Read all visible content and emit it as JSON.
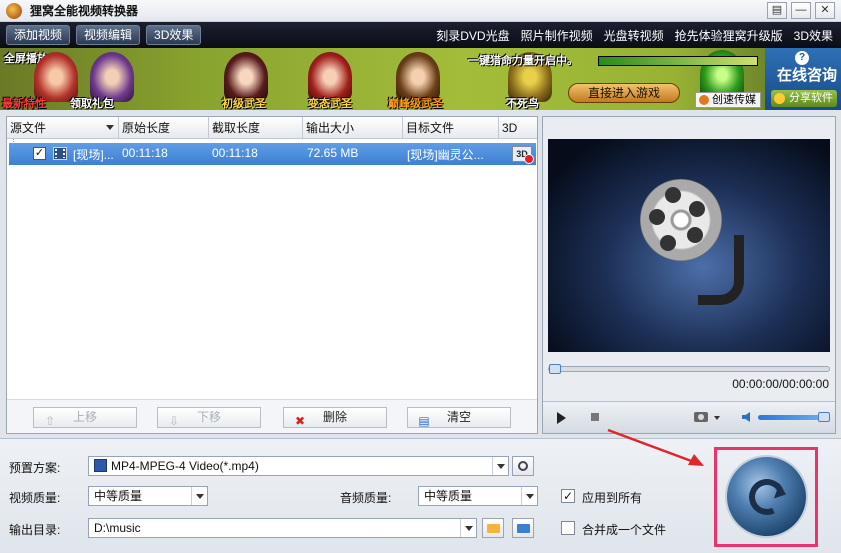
{
  "app": {
    "title": "狸窝全能视频转换器"
  },
  "window_controls": {
    "menu": "▤",
    "minimize": "—",
    "close": "✕"
  },
  "toolbar": {
    "left_buttons": [
      "添加视频",
      "视频编辑",
      "3D效果"
    ],
    "right_links": [
      "刻录DVD光盘",
      "照片制作视频",
      "光盘转视频",
      "抢先体验狸窝升级版",
      "3D效果"
    ]
  },
  "banner": {
    "fullscreen": "全屏播放",
    "promo": "一键猎命力量开启中。",
    "enter_game": "直接进入游戏",
    "consult": "在线咨询",
    "help": "?",
    "share": "分享软件",
    "chuanmei": "创速传媒",
    "captions": [
      "最新特性",
      "领取礼包",
      "初级武圣",
      "变态武圣",
      "巅峰级武圣",
      "不死鸟"
    ]
  },
  "list": {
    "columns": [
      "源文件",
      "原始长度",
      "截取长度",
      "输出大小",
      "目标文件",
      "3D"
    ],
    "rows": [
      {
        "source": "[现场]...",
        "original_length": "00:11:18",
        "cut_length": "00:11:18",
        "output_size": "72.65 MB",
        "target": "[现场]幽灵公...",
        "badge_3d": "3D",
        "checked": "✓"
      }
    ],
    "actions": {
      "up": "上移",
      "down": "下移",
      "delete": "删除",
      "clear": "清空"
    }
  },
  "preview": {
    "time": "00:00:00/00:00:00"
  },
  "settings": {
    "preset_label": "预置方案:",
    "preset_value": "MP4-MPEG-4 Video(*.mp4)",
    "video_quality_label": "视频质量:",
    "video_quality_value": "中等质量",
    "audio_quality_label": "音频质量:",
    "audio_quality_value": "中等质量",
    "apply_all_label": "应用到所有",
    "apply_all_check": "✓",
    "output_label": "输出目录:",
    "output_value": "D:\\music",
    "merge_label": "合并成一个文件"
  },
  "colors": {
    "highlight": "#e8336b",
    "row_selected": "#4f8fdc",
    "toolbar_bg": "#12151f"
  }
}
